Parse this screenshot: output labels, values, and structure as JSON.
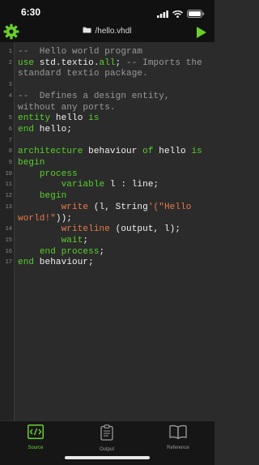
{
  "status_bar": {
    "time": "6:30"
  },
  "nav": {
    "title": "/hello.vhdl",
    "left_icon": "gear-icon",
    "right_icon": "play-icon",
    "title_icon": "folder-icon"
  },
  "colors": {
    "accent": "#6ad12a",
    "comment": "#9a9a9a",
    "keyword": "#57d12a",
    "string": "#ea7a4b",
    "plain": "#f2f2f2",
    "line_number": "#8a8a8a",
    "editor_bg": "#2b2b2b",
    "bar_bg": "#111111"
  },
  "editor": {
    "lines": [
      {
        "n": "1",
        "tokens": [
          {
            "t": "--  Hello world program",
            "k": "comment"
          }
        ]
      },
      {
        "n": "2",
        "tokens": [
          {
            "t": "use",
            "k": "keyword"
          },
          {
            "t": " std.textio.",
            "k": "plain"
          },
          {
            "t": "all",
            "k": "keyword"
          },
          {
            "t": "; ",
            "k": "plain"
          },
          {
            "t": "-- Imports the",
            "k": "comment"
          }
        ]
      },
      {
        "n": "",
        "tokens": [
          {
            "t": "standard textio package.",
            "k": "comment"
          }
        ]
      },
      {
        "n": "3",
        "tokens": []
      },
      {
        "n": "4",
        "tokens": [
          {
            "t": "--  Defines a design entity,",
            "k": "comment"
          }
        ]
      },
      {
        "n": "",
        "tokens": [
          {
            "t": "without any ports.",
            "k": "comment"
          }
        ]
      },
      {
        "n": "5",
        "tokens": [
          {
            "t": "entity",
            "k": "keyword"
          },
          {
            "t": " hello ",
            "k": "plain"
          },
          {
            "t": "is",
            "k": "keyword"
          }
        ]
      },
      {
        "n": "6",
        "tokens": [
          {
            "t": "end",
            "k": "keyword"
          },
          {
            "t": " hello;",
            "k": "plain"
          }
        ]
      },
      {
        "n": "7",
        "tokens": []
      },
      {
        "n": "8",
        "tokens": [
          {
            "t": "architecture",
            "k": "keyword"
          },
          {
            "t": " behaviour ",
            "k": "plain"
          },
          {
            "t": "of",
            "k": "keyword"
          },
          {
            "t": " hello ",
            "k": "plain"
          },
          {
            "t": "is",
            "k": "keyword"
          }
        ]
      },
      {
        "n": "9",
        "tokens": [
          {
            "t": "begin",
            "k": "keyword"
          }
        ]
      },
      {
        "n": "10",
        "tokens": [
          {
            "t": "    ",
            "k": "plain"
          },
          {
            "t": "process",
            "k": "keyword"
          }
        ]
      },
      {
        "n": "11",
        "tokens": [
          {
            "t": "        ",
            "k": "plain"
          },
          {
            "t": "variable",
            "k": "keyword"
          },
          {
            "t": " l : line;",
            "k": "plain"
          }
        ]
      },
      {
        "n": "12",
        "tokens": [
          {
            "t": "    ",
            "k": "plain"
          },
          {
            "t": "begin",
            "k": "keyword"
          }
        ]
      },
      {
        "n": "13",
        "tokens": [
          {
            "t": "        ",
            "k": "plain"
          },
          {
            "t": "write",
            "k": "string"
          },
          {
            "t": " (l, String",
            "k": "plain"
          },
          {
            "t": "'(\"Hello",
            "k": "string"
          }
        ]
      },
      {
        "n": "",
        "tokens": [
          {
            "t": "world!\"",
            "k": "string"
          },
          {
            "t": "));",
            "k": "plain"
          }
        ]
      },
      {
        "n": "14",
        "tokens": [
          {
            "t": "        ",
            "k": "plain"
          },
          {
            "t": "writeline",
            "k": "string"
          },
          {
            "t": " (output, l);",
            "k": "plain"
          }
        ]
      },
      {
        "n": "15",
        "tokens": [
          {
            "t": "        ",
            "k": "plain"
          },
          {
            "t": "wait",
            "k": "keyword"
          },
          {
            "t": ";",
            "k": "plain"
          }
        ]
      },
      {
        "n": "16",
        "tokens": [
          {
            "t": "    ",
            "k": "plain"
          },
          {
            "t": "end process",
            "k": "keyword"
          },
          {
            "t": ";",
            "k": "plain"
          }
        ]
      },
      {
        "n": "17",
        "tokens": [
          {
            "t": "end",
            "k": "keyword"
          },
          {
            "t": " behaviour;",
            "k": "plain"
          }
        ]
      }
    ]
  },
  "tabs": [
    {
      "label": "Source",
      "icon": "code-file-icon",
      "active": true
    },
    {
      "label": "Output",
      "icon": "clipboard-icon",
      "active": false
    },
    {
      "label": "Reference",
      "icon": "book-icon",
      "active": false
    }
  ]
}
